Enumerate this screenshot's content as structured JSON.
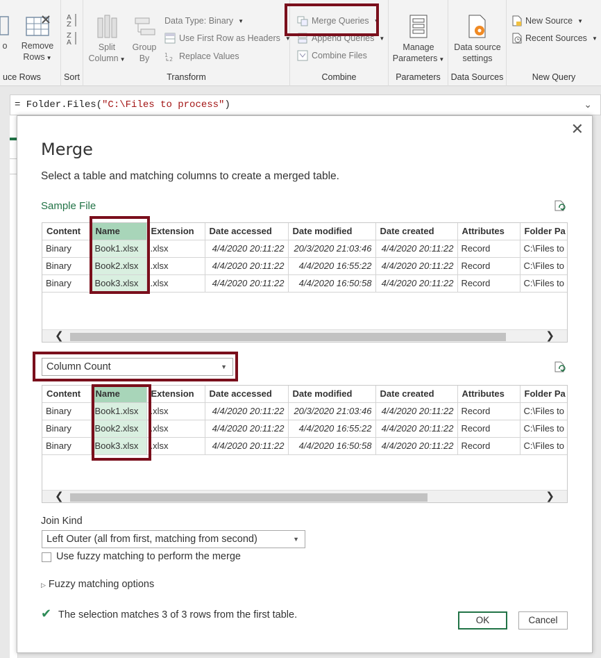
{
  "ribbon": {
    "reduce_rows": {
      "remove_rows_label": "Remove Rows",
      "group_label": "uce Rows",
      "partial_label": "o"
    },
    "sort": {
      "group_label": "Sort"
    },
    "transform": {
      "split_column_label": "Split Column",
      "group_by_label": "Group By",
      "data_type_label": "Data Type: Binary",
      "first_row_label": "Use First Row as Headers",
      "replace_values_label": "Replace Values",
      "group_label": "Transform"
    },
    "combine": {
      "merge_label": "Merge Queries",
      "append_label": "Append Queries",
      "combine_files_label": "Combine Files",
      "group_label": "Combine"
    },
    "parameters": {
      "manage_label": "Manage Parameters",
      "group_label": "Parameters"
    },
    "data_sources": {
      "settings_label": "Data source settings",
      "group_label": "Data Sources"
    },
    "new_query": {
      "new_source_label": "New Source",
      "recent_sources_label": "Recent Sources",
      "group_label": "New Query"
    }
  },
  "formula": {
    "prefix": "= Folder.Files(",
    "string": "\"C:\\Files to process\"",
    "suffix": ")"
  },
  "dialog": {
    "title": "Merge",
    "subtitle": "Select a table and matching columns to create a merged table.",
    "first_table_name": "Sample File",
    "second_table_selected": "Column Count",
    "columns": [
      "Content",
      "Name",
      "Extension",
      "Date accessed",
      "Date modified",
      "Date created",
      "Attributes",
      "Folder Pa"
    ],
    "table1_rows": [
      [
        "Binary",
        "Book1.xlsx",
        ".xlsx",
        "4/4/2020 20:11:22",
        "20/3/2020 21:03:46",
        "4/4/2020 20:11:22",
        "Record",
        "C:\\Files to"
      ],
      [
        "Binary",
        "Book2.xlsx",
        ".xlsx",
        "4/4/2020 20:11:22",
        "4/4/2020 16:55:22",
        "4/4/2020 20:11:22",
        "Record",
        "C:\\Files to"
      ],
      [
        "Binary",
        "Book3.xlsx",
        ".xlsx",
        "4/4/2020 20:11:22",
        "4/4/2020 16:50:58",
        "4/4/2020 20:11:22",
        "Record",
        "C:\\Files to"
      ]
    ],
    "table2_rows": [
      [
        "Binary",
        "Book1.xlsx",
        ".xlsx",
        "4/4/2020 20:11:22",
        "20/3/2020 21:03:46",
        "4/4/2020 20:11:22",
        "Record",
        "C:\\Files to"
      ],
      [
        "Binary",
        "Book2.xlsx",
        ".xlsx",
        "4/4/2020 20:11:22",
        "4/4/2020 16:55:22",
        "4/4/2020 20:11:22",
        "Record",
        "C:\\Files to"
      ],
      [
        "Binary",
        "Book3.xlsx",
        ".xlsx",
        "4/4/2020 20:11:22",
        "4/4/2020 16:50:58",
        "4/4/2020 20:11:22",
        "Record",
        "C:\\Files to"
      ]
    ],
    "join_kind_label": "Join Kind",
    "join_kind_value": "Left Outer (all from first, matching from second)",
    "fuzzy_checkbox_label": "Use fuzzy matching to perform the merge",
    "fuzzy_options_label": "Fuzzy matching options",
    "status_text": "The selection matches 3 of 3 rows from the first table.",
    "ok_label": "OK",
    "cancel_label": "Cancel"
  },
  "colors": {
    "accent_green": "#217346",
    "highlight_box": "#7a0f1c",
    "selected_header": "#a8d5b9",
    "selected_cell": "#d9efe0"
  }
}
